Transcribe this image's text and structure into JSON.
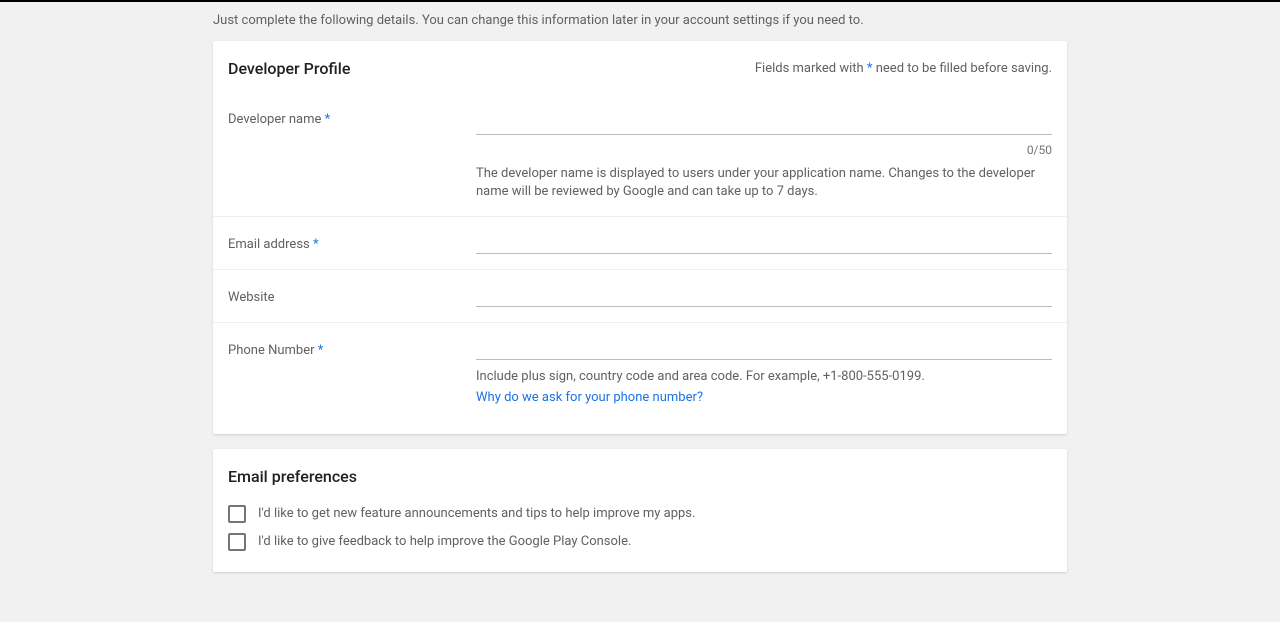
{
  "intro": "Just complete the following details. You can change this information later in your account settings if you need to.",
  "profile": {
    "title": "Developer Profile",
    "required_prefix": "Fields marked with",
    "required_suffix": "need to be filled before saving.",
    "fields": {
      "devname": {
        "label": "Developer name",
        "required": true,
        "counter": "0/50",
        "helper": "The developer name is displayed to users under your application name. Changes to the developer name will be reviewed by Google and can take up to 7 days."
      },
      "email": {
        "label": "Email address",
        "required": true
      },
      "website": {
        "label": "Website",
        "required": false
      },
      "phone": {
        "label": "Phone Number",
        "required": true,
        "helper": "Include plus sign, country code and area code. For example, +1-800-555-0199.",
        "link": "Why do we ask for your phone number?"
      }
    }
  },
  "emailprefs": {
    "title": "Email preferences",
    "opt1": "I'd like to get new feature announcements and tips to help improve my apps.",
    "opt2": "I'd like to give feedback to help improve the Google Play Console."
  }
}
